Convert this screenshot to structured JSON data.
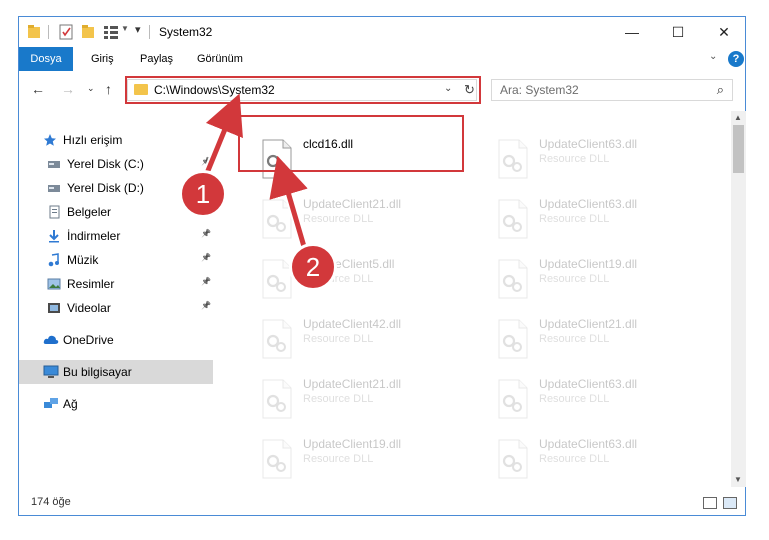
{
  "window": {
    "title": "System32",
    "controls": {
      "minimize": "—",
      "maximize": "☐",
      "close": "✕"
    }
  },
  "ribbon": {
    "tabs": [
      "Dosya",
      "Giriş",
      "Paylaş",
      "Görünüm"
    ],
    "help": "?"
  },
  "address": {
    "path": "C:\\Windows\\System32",
    "search_placeholder": "Ara: System32"
  },
  "sidebar": {
    "items": [
      {
        "label": "Hızlı erişim",
        "icon": "star-icon",
        "pinned": false,
        "indent": 0
      },
      {
        "label": "Yerel Disk (C:)",
        "icon": "drive-icon",
        "pinned": true,
        "indent": 1
      },
      {
        "label": "Yerel Disk (D:)",
        "icon": "drive-icon",
        "pinned": false,
        "indent": 1
      },
      {
        "label": "Belgeler",
        "icon": "documents-icon",
        "pinned": false,
        "indent": 1
      },
      {
        "label": "İndirmeler",
        "icon": "download-icon",
        "pinned": true,
        "indent": 1
      },
      {
        "label": "Müzik",
        "icon": "music-icon",
        "pinned": true,
        "indent": 1
      },
      {
        "label": "Resimler",
        "icon": "pictures-icon",
        "pinned": true,
        "indent": 1
      },
      {
        "label": "Videolar",
        "icon": "video-icon",
        "pinned": true,
        "indent": 1
      },
      {
        "label": "OneDrive",
        "icon": "cloud-icon",
        "pinned": false,
        "indent": 0
      },
      {
        "label": "Bu bilgisayar",
        "icon": "computer-icon",
        "pinned": false,
        "indent": 0,
        "selected": true
      },
      {
        "label": "Ağ",
        "icon": "network-icon",
        "pinned": false,
        "indent": 0
      }
    ]
  },
  "files": {
    "col1": [
      {
        "name": "clcd16.dll",
        "type": "",
        "highlight": true
      },
      {
        "name": "UpdateClient21.dll",
        "type": "Resource DLL"
      },
      {
        "name": "UpdateClient5.dll",
        "type": "Resource DLL"
      },
      {
        "name": "UpdateClient42.dll",
        "type": "Resource DLL"
      },
      {
        "name": "UpdateClient21.dll",
        "type": "Resource DLL"
      },
      {
        "name": "UpdateClient19.dll",
        "type": "Resource DLL"
      }
    ],
    "col2": [
      {
        "name": "UpdateClient63.dll",
        "type": "Resource DLL"
      },
      {
        "name": "UpdateClient63.dll",
        "type": "Resource DLL"
      },
      {
        "name": "UpdateClient19.dll",
        "type": "Resource DLL"
      },
      {
        "name": "UpdateClient21.dll",
        "type": "Resource DLL"
      },
      {
        "name": "UpdateClient63.dll",
        "type": "Resource DLL"
      },
      {
        "name": "UpdateClient63.dll",
        "type": "Resource DLL"
      }
    ]
  },
  "status": {
    "count": "174 öğe"
  },
  "callouts": [
    "1",
    "2"
  ],
  "colors": {
    "accent": "#1979ca",
    "highlight": "#d2383b",
    "folder": "#f3c44b"
  }
}
